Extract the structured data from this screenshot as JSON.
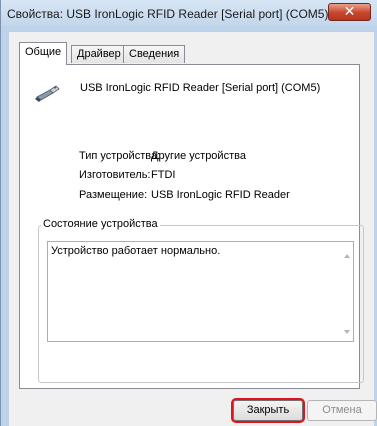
{
  "window": {
    "title": "Свойства: USB IronLogic RFID Reader [Serial port] (COM5)",
    "close_glyph": "✕"
  },
  "tabs": [
    {
      "label": "Общие",
      "active": true
    },
    {
      "label": "Драйвер",
      "active": false
    },
    {
      "label": "Сведения",
      "active": false
    }
  ],
  "device": {
    "icon": "usb-connector-icon",
    "name": "USB IronLogic RFID Reader [Serial port] (COM5)"
  },
  "properties": [
    {
      "label": "Тип устройства:",
      "value": "Другие устройства"
    },
    {
      "label": "Изготовитель:",
      "value": "FTDI"
    },
    {
      "label": "Размещение:",
      "value": "USB IronLogic RFID Reader"
    }
  ],
  "status": {
    "group_label": "Состояние устройства",
    "text": "Устройство работает нормально."
  },
  "buttons": {
    "close_label": "Закрыть",
    "cancel_label": "Отмена"
  },
  "colors": {
    "close_highlight": "#e0141c",
    "title_close_button": "#c8452c"
  }
}
